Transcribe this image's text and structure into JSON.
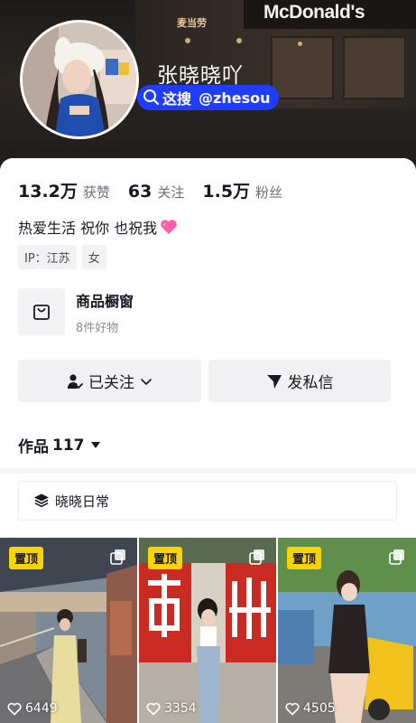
{
  "header": {
    "storefront_sign": "McDonald's",
    "storefront_small_sign": "麦当劳",
    "nickname": "张晓晓吖",
    "search_pill": {
      "prefix": "这搜",
      "handle": "@zhesou"
    }
  },
  "stats": [
    {
      "value": "13.2万",
      "label": "获赞"
    },
    {
      "value": "63",
      "label": "关注"
    },
    {
      "value": "1.5万",
      "label": "粉丝"
    }
  ],
  "bio": "热爱生活 祝你 也祝我",
  "tags": [
    "IP：江苏",
    "女"
  ],
  "shop": {
    "title": "商品橱窗",
    "subtitle": "8件好物"
  },
  "actions": {
    "follow_label": "已关注",
    "message_label": "发私信"
  },
  "works": {
    "label": "作品",
    "count": "117"
  },
  "collection": {
    "label": "晓晓日常"
  },
  "videos": [
    {
      "badge": "置顶",
      "likes": "6449",
      "scene": "underpass"
    },
    {
      "badge": "置顶",
      "likes": "3354",
      "scene": "red-wall"
    },
    {
      "badge": "置顶",
      "likes": "4505",
      "scene": "scooter"
    }
  ],
  "colors": {
    "accent_pill": "#1f3cff",
    "badge": "#fbd400",
    "heart": "#fe2c55",
    "text_primary": "#161823",
    "text_secondary": "#6b6d75"
  }
}
